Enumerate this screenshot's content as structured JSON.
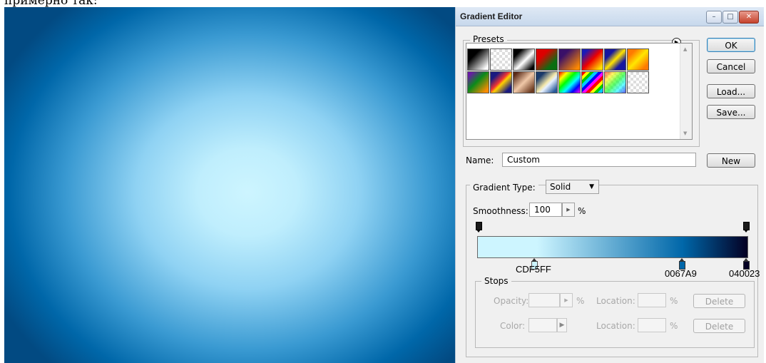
{
  "caption": "примерно так:",
  "dialog": {
    "title": "Gradient Editor",
    "window_buttons": {
      "minimize": "–",
      "maximize": "□",
      "close": "✕"
    },
    "presets_label": "Presets",
    "presets_menu_icon": "circle-arrow-icon",
    "buttons": {
      "ok": "OK",
      "cancel": "Cancel",
      "load": "Load...",
      "save": "Save...",
      "new": "New"
    },
    "name_label": "Name:",
    "name_value": "Custom",
    "gradient_type_label": "Gradient Type:",
    "gradient_type_value": "Solid",
    "smoothness_label": "Smoothness:",
    "smoothness_value": "100",
    "smoothness_unit": "%",
    "color_stops": [
      {
        "label": "CDF5FF",
        "color": "#cdf5ff"
      },
      {
        "label": "0067A9",
        "color": "#0067a9"
      },
      {
        "label": "040023",
        "color": "#040023"
      }
    ],
    "stops": {
      "label": "Stops",
      "opacity_label": "Opacity:",
      "opacity_unit": "%",
      "color_label": "Color:",
      "location_label": "Location:",
      "location_unit": "%",
      "delete_label": "Delete"
    }
  },
  "presets": [
    "black-white",
    "transparent-checker",
    "black-white-black",
    "red-green",
    "violet-orange",
    "blue-red-yellow",
    "blue-yellow-blue",
    "orange-yellow-orange",
    "violet-green-orange",
    "rainbow-diagonal",
    "copper",
    "chrome",
    "spectrum",
    "rainbow-stripes",
    "transparent-rainbow",
    "transparent-checker-2"
  ]
}
